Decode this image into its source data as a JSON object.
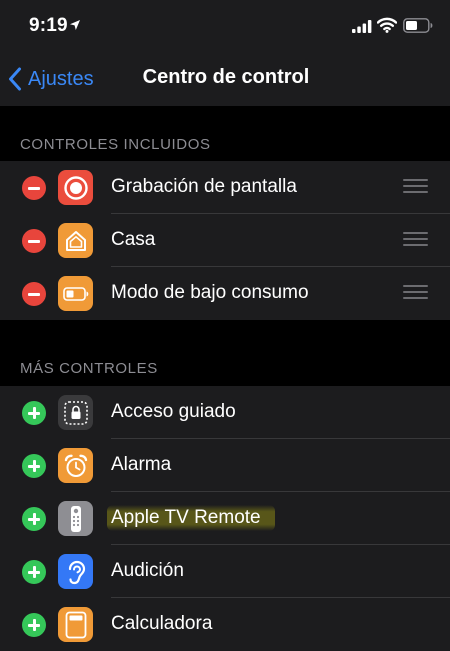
{
  "status_bar": {
    "time": "9:19"
  },
  "nav": {
    "back_label": "Ajustes",
    "title": "Centro de control"
  },
  "included": {
    "header": "CONTROLES INCLUIDOS",
    "items": [
      {
        "label": "Grabación de pantalla",
        "icon": "screen-record-icon",
        "color": "#eb4d3d"
      },
      {
        "label": "Casa",
        "icon": "home-icon",
        "color": "#f09a37"
      },
      {
        "label": "Modo de bajo consumo",
        "icon": "low-power-battery-icon",
        "color": "#f09a37"
      }
    ]
  },
  "more": {
    "header": "MÁS CONTROLES",
    "items": [
      {
        "label": "Acceso guiado",
        "icon": "guided-access-lock-icon",
        "color": "#3a3a3c"
      },
      {
        "label": "Alarma",
        "icon": "alarm-clock-icon",
        "color": "#f09a37"
      },
      {
        "label": "Apple TV Remote",
        "icon": "tv-remote-icon",
        "color": "#8e8e93"
      },
      {
        "label": "Audición",
        "icon": "ear-icon",
        "color": "#3478f6"
      },
      {
        "label": "Calculadora",
        "icon": "calculator-icon",
        "color": "#f09a37"
      }
    ]
  },
  "colors": {
    "accent": "#3a88f6",
    "remove": "#e8453c",
    "add": "#35c759",
    "group_bg": "#1c1c1e",
    "page_bg": "#000000"
  }
}
